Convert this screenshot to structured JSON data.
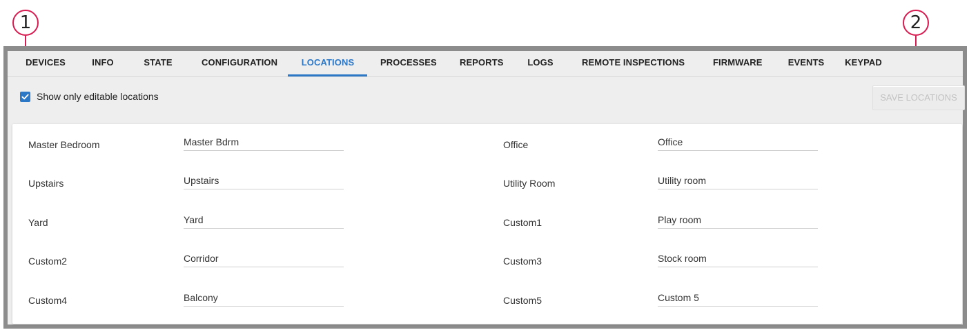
{
  "callouts": [
    "1",
    "2"
  ],
  "tabs": [
    {
      "label": "DEVICES"
    },
    {
      "label": "INFO"
    },
    {
      "label": "STATE"
    },
    {
      "label": "CONFIGURATION"
    },
    {
      "label": "LOCATIONS"
    },
    {
      "label": "PROCESSES"
    },
    {
      "label": "REPORTS"
    },
    {
      "label": "LOGS"
    },
    {
      "label": "REMOTE INSPECTIONS"
    },
    {
      "label": "FIRMWARE"
    },
    {
      "label": "EVENTS"
    },
    {
      "label": "KEYPAD"
    }
  ],
  "active_tab": "LOCATIONS",
  "filter": {
    "label": "Show only editable locations",
    "checked": true
  },
  "save_button": {
    "label": "SAVE LOCATIONS",
    "enabled": false
  },
  "locations": [
    {
      "name": "Master Bedroom",
      "value": "Master Bdrm"
    },
    {
      "name": "Office",
      "value": "Office"
    },
    {
      "name": "Upstairs",
      "value": "Upstairs"
    },
    {
      "name": "Utility Room",
      "value": "Utility room"
    },
    {
      "name": "Yard",
      "value": "Yard"
    },
    {
      "name": "Custom1",
      "value": "Play room"
    },
    {
      "name": "Custom2",
      "value": "Corridor"
    },
    {
      "name": "Custom3",
      "value": "Stock room"
    },
    {
      "name": "Custom4",
      "value": "Balcony"
    },
    {
      "name": "Custom5",
      "value": "Custom 5"
    }
  ],
  "colors": {
    "accent": "#2c78c7",
    "callout": "#d81b50",
    "frame": "#8c8c8c"
  }
}
